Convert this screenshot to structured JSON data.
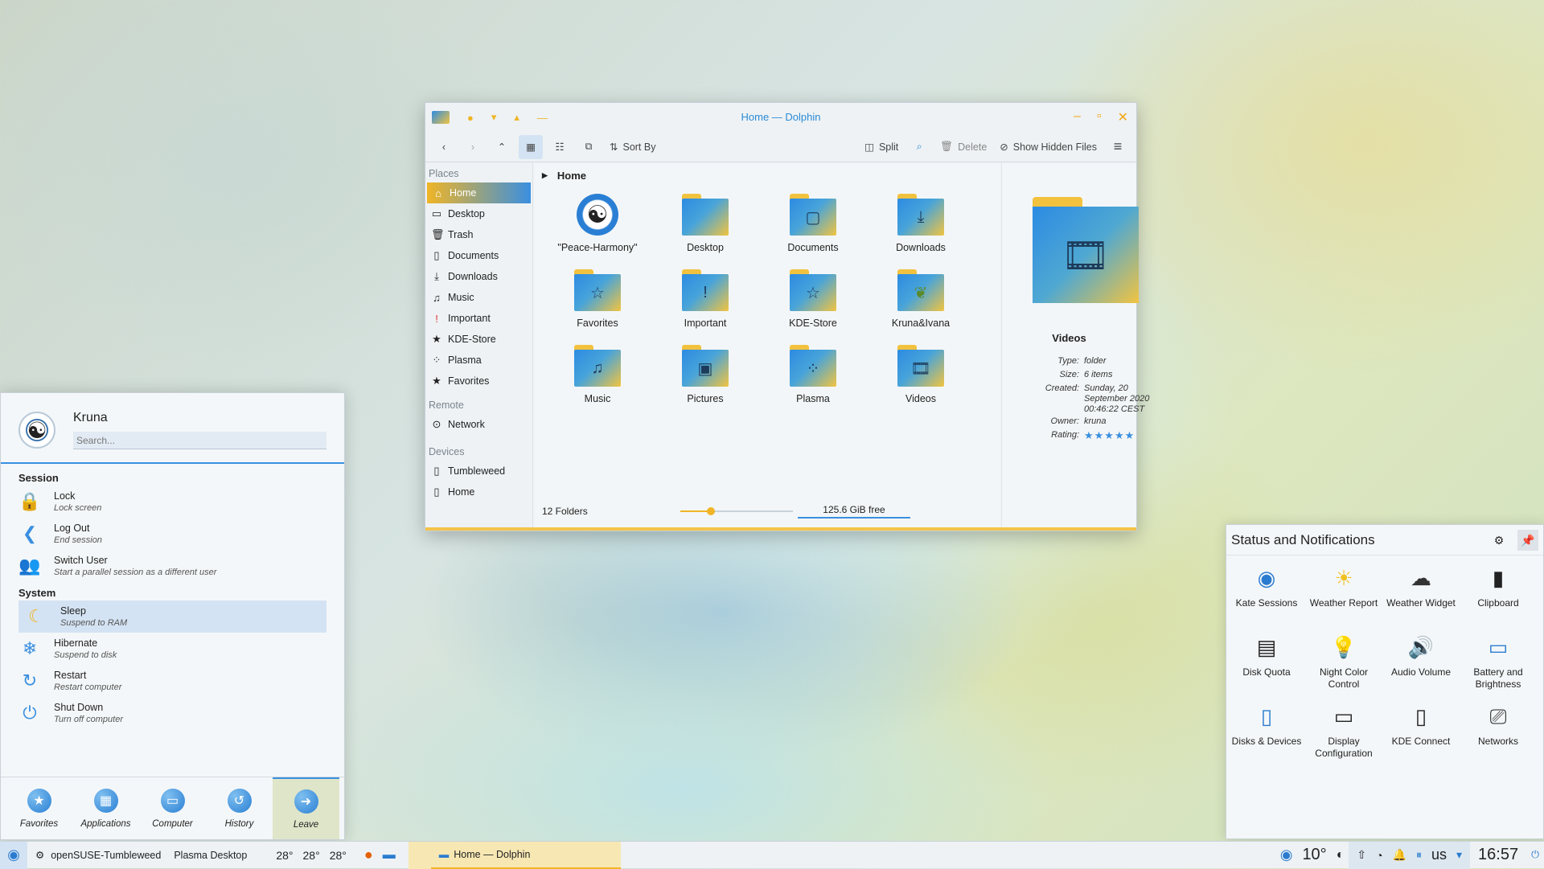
{
  "window": {
    "title": "Home — Dolphin"
  },
  "toolbar": {
    "sort": "Sort By",
    "split": "Split",
    "delete": "Delete",
    "hidden": "Show Hidden Files"
  },
  "sidebar": {
    "places_title": "Places",
    "places": [
      "Home",
      "Desktop",
      "Trash",
      "Documents",
      "Downloads",
      "Music",
      "Important",
      "KDE-Store",
      "Plasma",
      "Favorites"
    ],
    "remote_title": "Remote",
    "remote": [
      "Network"
    ],
    "devices_title": "Devices",
    "devices": [
      "Tumbleweed",
      "Home"
    ]
  },
  "breadcrumb": "Home",
  "files": [
    "\"Peace-Harmony\"",
    "Desktop",
    "Documents",
    "Downloads",
    "Favorites",
    "Important",
    "KDE-Store",
    "Kruna&Ivana",
    "Music",
    "Pictures",
    "Plasma",
    "Videos"
  ],
  "status": {
    "folders": "12 Folders",
    "free": "125.6 GiB free",
    "zoom": 0.27
  },
  "info": {
    "name": "Videos",
    "labels": {
      "type": "Type:",
      "size": "Size:",
      "created": "Created:",
      "owner": "Owner:",
      "rating": "Rating:"
    },
    "type": "folder",
    "size": "6 items",
    "created": "Sunday, 20 September 2020 00:46:22 CEST",
    "owner": "kruna",
    "rating": 5
  },
  "launcher": {
    "user": "Kruna",
    "search_placeholder": "Search...",
    "session_title": "Session",
    "session": [
      {
        "t": "Lock",
        "s": "Lock screen"
      },
      {
        "t": "Log Out",
        "s": "End session"
      },
      {
        "t": "Switch User",
        "s": "Start a parallel session as a different user"
      }
    ],
    "system_title": "System",
    "system": [
      {
        "t": "Sleep",
        "s": "Suspend to RAM"
      },
      {
        "t": "Hibernate",
        "s": "Suspend to disk"
      },
      {
        "t": "Restart",
        "s": "Restart computer"
      },
      {
        "t": "Shut Down",
        "s": "Turn off computer"
      }
    ],
    "tabs": [
      "Favorites",
      "Applications",
      "Computer",
      "History",
      "Leave"
    ]
  },
  "tray": {
    "title": "Status and Notifications",
    "items": [
      "Kate Sessions",
      "Weather Report",
      "Weather Widget",
      "Clipboard",
      "Disk Quota",
      "Night Color Control",
      "Audio Volume",
      "Battery and Brightness",
      "Disks & Devices",
      "Display Configuration",
      "KDE Connect",
      "Networks"
    ]
  },
  "panel": {
    "os": "openSUSE-Tumbleweed",
    "desktop": "Plasma Desktop",
    "temps": [
      "28°",
      "28°",
      "28°"
    ],
    "task": "Home — Dolphin",
    "weather": "10°",
    "layout": "us",
    "time": "16:57"
  }
}
